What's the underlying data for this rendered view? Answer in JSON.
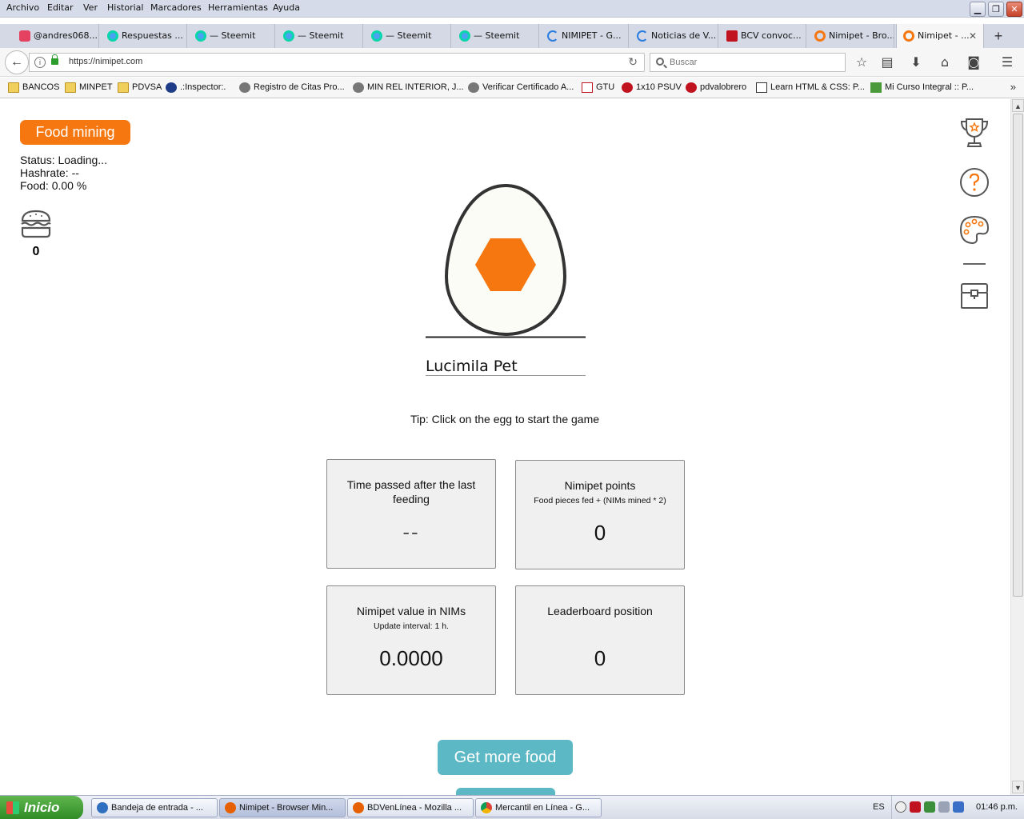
{
  "menubar": {
    "items": [
      "Archivo",
      "Editar",
      "Ver",
      "Historial",
      "Marcadores",
      "Herramientas",
      "Ayuda"
    ]
  },
  "tabs": [
    {
      "label": "@andres068...",
      "icon": "instagram-icon"
    },
    {
      "label": "Respuestas ...",
      "icon": "steemit-icon"
    },
    {
      "label": "— Steemit",
      "icon": "steemit-icon"
    },
    {
      "label": "— Steemit",
      "icon": "steemit-icon"
    },
    {
      "label": "— Steemit",
      "icon": "steemit-icon"
    },
    {
      "label": "— Steemit",
      "icon": "steemit-icon"
    },
    {
      "label": "NIMIPET - G...",
      "icon": "loading-icon"
    },
    {
      "label": "Noticias de V...",
      "icon": "loading-icon"
    },
    {
      "label": "BCV convoc...",
      "icon": "bcv-icon"
    },
    {
      "label": "Nimipet - Bro...",
      "icon": "nimipet-icon"
    },
    {
      "label": "Nimipet - ...",
      "icon": "nimipet-icon"
    }
  ],
  "navbar": {
    "url": "https://nimipet.com",
    "search_placeholder": "Buscar"
  },
  "bookmarks": [
    {
      "label": "BANCOS",
      "icon": "folder-icon"
    },
    {
      "label": "MINPET",
      "icon": "folder-icon"
    },
    {
      "label": "PDVSA",
      "icon": "folder-icon"
    },
    {
      "label": ".:Inspector:.",
      "icon": "seal-icon"
    },
    {
      "label": "Registro de Citas Pro...",
      "icon": "globe-icon"
    },
    {
      "label": "MIN REL INTERIOR, J...",
      "icon": "globe-icon"
    },
    {
      "label": "Verificar Certificado A...",
      "icon": "globe-icon"
    },
    {
      "label": "GTU",
      "icon": "gtu-icon"
    },
    {
      "label": "1x10 PSUV",
      "icon": "psuv-icon"
    },
    {
      "label": "pdvalobrero",
      "icon": "pdval-icon"
    },
    {
      "label": "Learn HTML & CSS: P...",
      "icon": "html-icon"
    },
    {
      "label": "Mi Curso Integral :: P...",
      "icon": "course-icon"
    }
  ],
  "page": {
    "food_mining_label": "Food mining",
    "status": "Status: Loading...",
    "hashrate": "Hashrate: --",
    "food": "Food: 0.00 %",
    "food_count": "0",
    "pet_name": "Lucimila Pet",
    "tip": "Tip: Click on the egg to start the game",
    "cards": [
      {
        "title": "Time passed after the last feeding",
        "subtitle": "",
        "value": "--"
      },
      {
        "title": "Nimipet points",
        "subtitle": "Food pieces fed + (NIMs mined * 2)",
        "value": "0"
      },
      {
        "title": "Nimipet value in NIMs",
        "subtitle": "Update interval: 1 h.",
        "value": "0.0000"
      },
      {
        "title": "Leaderboard position",
        "subtitle": "",
        "value": "0"
      }
    ],
    "get_more_food_label": "Get more food",
    "colors": {
      "accent_orange": "#f6770f",
      "accent_teal": "#5db8c6",
      "card_bg": "#f0f0f0"
    }
  },
  "taskbar": {
    "start_label": "Inicio",
    "tasks": [
      {
        "label": "Bandeja de entrada - ...",
        "icon": "thunderbird-icon"
      },
      {
        "label": "Nimipet - Browser Min...",
        "icon": "firefox-icon"
      },
      {
        "label": "BDVenLínea - Mozilla ...",
        "icon": "firefox-icon"
      },
      {
        "label": "Mercantil en Línea - G...",
        "icon": "chrome-icon"
      }
    ],
    "language": "ES",
    "clock": "01:46 p.m."
  }
}
